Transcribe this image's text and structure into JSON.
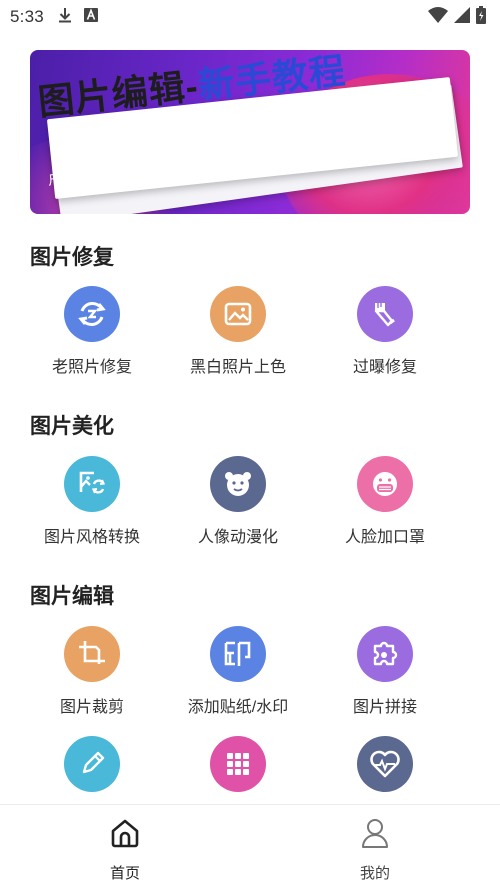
{
  "status_bar": {
    "time": "5:33",
    "icons": [
      "download-icon",
      "a-icon",
      "wifi-icon",
      "signal-icon",
      "battery-icon"
    ]
  },
  "banner": {
    "title_black": "图片编辑-",
    "title_blue": "新手教程",
    "subtitle": "尺寸裁剪、水印、拼接、标注、压缩、图片识别"
  },
  "sections": {
    "repair": {
      "title": "图片修复",
      "items": [
        {
          "label": "老照片修复",
          "icon": "rotate-photo-icon",
          "color": "#5b83e3"
        },
        {
          "label": "黑白照片上色",
          "icon": "picture-icon",
          "color": "#e8a263"
        },
        {
          "label": "过曝修复",
          "icon": "brush-icon",
          "color": "#9a6ce0"
        }
      ]
    },
    "beautify": {
      "title": "图片美化",
      "items": [
        {
          "label": "图片风格转换",
          "icon": "image-convert-icon",
          "color": "#49b8d9"
        },
        {
          "label": "人像动漫化",
          "icon": "cartoon-face-icon",
          "color": "#5b6890"
        },
        {
          "label": "人脸加口罩",
          "icon": "mask-face-icon",
          "color": "#ec6fa8"
        }
      ]
    },
    "edit": {
      "title": "图片编辑",
      "items": [
        {
          "label": "图片裁剪",
          "icon": "crop-icon",
          "color": "#e8a263"
        },
        {
          "label": "添加贴纸/水印",
          "icon": "stamp-icon",
          "color": "#5b83e3"
        },
        {
          "label": "图片拼接",
          "icon": "puzzle-icon",
          "color": "#9a6ce0"
        }
      ],
      "partial_items": [
        {
          "icon": "pencil-icon",
          "color": "#49b8d9"
        },
        {
          "icon": "grid-icon",
          "color": "#e052a8"
        },
        {
          "icon": "heart-pulse-icon",
          "color": "#5b6890"
        }
      ]
    }
  },
  "bottom_nav": {
    "home": "首页",
    "mine": "我的"
  }
}
